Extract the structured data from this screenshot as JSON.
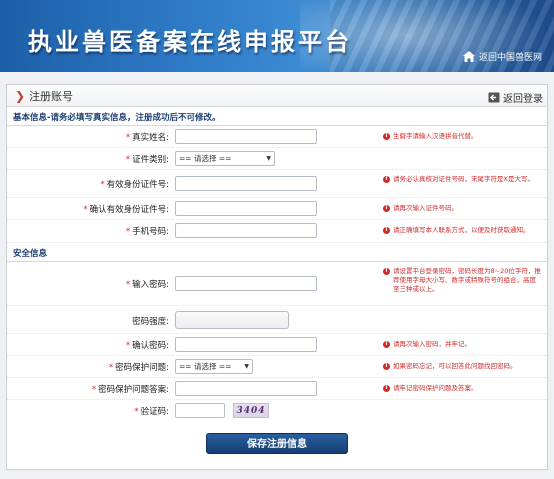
{
  "banner": {
    "title": "执业兽医备案在线申报平台",
    "back_home": "返回中国兽医网"
  },
  "panel": {
    "title": "注册账号",
    "back_login": "返回登录"
  },
  "sections": {
    "basic": "基本信息-请务必填写真实信息，注册成功后不可修改。",
    "security": "安全信息"
  },
  "fields": {
    "real_name": {
      "label": "真实姓名:",
      "hint": "生僻字请输入汉语拼音代替。"
    },
    "id_type": {
      "label": "证件类别:",
      "selected": "== 请选择 =="
    },
    "id_number": {
      "label": "有效身份证件号:",
      "hint": "请务必认真核对证件号码，末尾字符是X是大写。"
    },
    "id_confirm": {
      "label": "确认有效身份证件号:",
      "hint": "请再次输入证件号码。"
    },
    "phone": {
      "label": "手机号码:",
      "hint": "请正确填写本人联系方式，以便及时获取通知。"
    },
    "password": {
      "label": "输入密码:",
      "hint": "请设置平台登录密码，密码长度为8~20位字符，推荐使用字母大小写、数字或特殊符号的组合，高度至三种或以上。"
    },
    "strength": {
      "label": "密码强度:"
    },
    "password_confirm": {
      "label": "确认密码:",
      "hint": "请再次输入密码，并牢记。"
    },
    "question": {
      "label": "密码保护问题:",
      "selected": "== 请选择 ==",
      "hint": "如果密码忘记，可以回答此问题找回密码。"
    },
    "answer": {
      "label": "密码保护问题答案:",
      "hint": "请牢记密码保护问题及答案。"
    },
    "captcha": {
      "label": "验证码:",
      "image_text": "3404"
    }
  },
  "submit_label": "保存注册信息",
  "colors": {
    "required": "#d12a2a",
    "button": "#1f4f8a",
    "section_text": "#1d3f73"
  }
}
